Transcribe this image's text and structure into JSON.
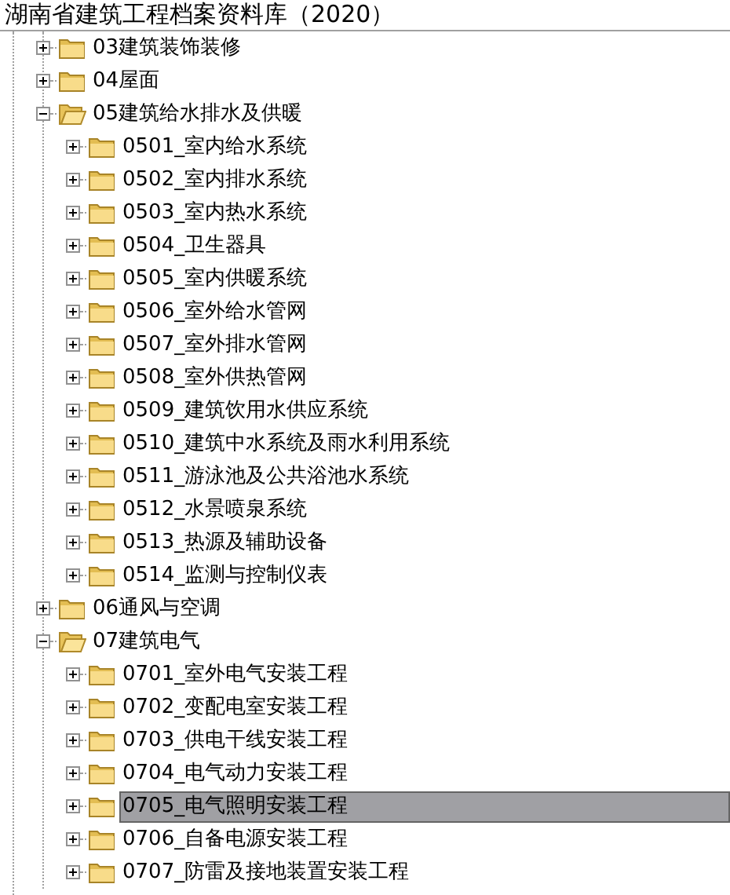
{
  "window": {
    "title": "湖南省建筑工程档案资料库（2020）"
  },
  "tree": [
    {
      "label": "03建筑装饰装修",
      "expanded": false
    },
    {
      "label": "04屋面",
      "expanded": false
    },
    {
      "label": "05建筑给水排水及供暖",
      "expanded": true,
      "children": [
        {
          "label": "0501_室内给水系统",
          "expanded": false,
          "selected": false
        },
        {
          "label": "0502_室内排水系统",
          "expanded": false,
          "selected": false
        },
        {
          "label": "0503_室内热水系统",
          "expanded": false,
          "selected": false
        },
        {
          "label": "0504_卫生器具",
          "expanded": false,
          "selected": false
        },
        {
          "label": "0505_室内供暖系统",
          "expanded": false,
          "selected": false
        },
        {
          "label": "0506_室外给水管网",
          "expanded": false,
          "selected": false
        },
        {
          "label": "0507_室外排水管网",
          "expanded": false,
          "selected": false
        },
        {
          "label": "0508_室外供热管网",
          "expanded": false,
          "selected": false
        },
        {
          "label": "0509_建筑饮用水供应系统",
          "expanded": false,
          "selected": false
        },
        {
          "label": "0510_建筑中水系统及雨水利用系统",
          "expanded": false,
          "selected": false
        },
        {
          "label": "0511_游泳池及公共浴池水系统",
          "expanded": false,
          "selected": false
        },
        {
          "label": "0512_水景喷泉系统",
          "expanded": false,
          "selected": false
        },
        {
          "label": "0513_热源及辅助设备",
          "expanded": false,
          "selected": false
        },
        {
          "label": "0514_监测与控制仪表",
          "expanded": false,
          "selected": false
        }
      ]
    },
    {
      "label": "06通风与空调",
      "expanded": false
    },
    {
      "label": "07建筑电气",
      "expanded": true,
      "children": [
        {
          "label": "0701_室外电气安装工程",
          "expanded": false,
          "selected": false
        },
        {
          "label": "0702_变配电室安装工程",
          "expanded": false,
          "selected": false
        },
        {
          "label": "0703_供电干线安装工程",
          "expanded": false,
          "selected": false
        },
        {
          "label": "0704_电气动力安装工程",
          "expanded": false,
          "selected": false
        },
        {
          "label": "0705_电气照明安装工程",
          "expanded": false,
          "selected": true
        },
        {
          "label": "0706_自备电源安装工程",
          "expanded": false,
          "selected": false
        },
        {
          "label": "0707_防雷及接地装置安装工程",
          "expanded": false,
          "selected": false
        }
      ]
    }
  ]
}
